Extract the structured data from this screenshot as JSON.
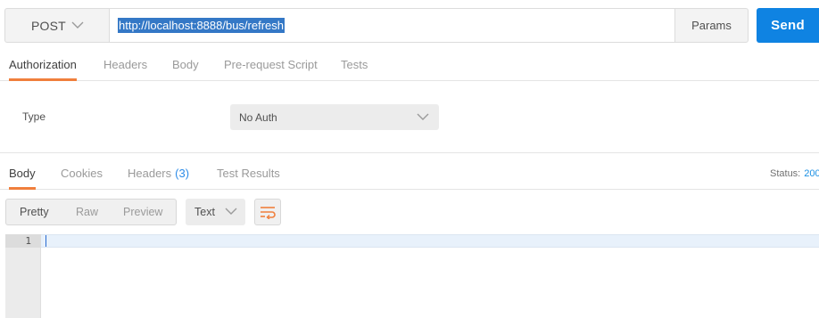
{
  "request": {
    "method": "POST",
    "url": "http://localhost:8888/bus/refresh",
    "params_label": "Params",
    "send_label": "Send"
  },
  "request_tabs": [
    {
      "label": "Authorization",
      "active": true
    },
    {
      "label": "Headers",
      "active": false
    },
    {
      "label": "Body",
      "active": false
    },
    {
      "label": "Pre-request Script",
      "active": false
    },
    {
      "label": "Tests",
      "active": false
    }
  ],
  "auth": {
    "type_label": "Type",
    "type_value": "No Auth"
  },
  "response_tabs": [
    {
      "label": "Body",
      "active": true
    },
    {
      "label": "Cookies",
      "active": false
    },
    {
      "label": "Headers",
      "count": "(3)",
      "active": false
    },
    {
      "label": "Test Results",
      "active": false
    }
  ],
  "status": {
    "label": "Status:",
    "value": "200"
  },
  "view_modes": [
    {
      "label": "Pretty",
      "active": true
    },
    {
      "label": "Raw",
      "active": false
    },
    {
      "label": "Preview",
      "active": false
    }
  ],
  "format": {
    "value": "Text"
  },
  "editor": {
    "line_numbers": [
      "1"
    ]
  },
  "icons": {
    "method_chevron": "chevron-down-icon",
    "auth_chevron": "chevron-down-icon",
    "format_chevron": "chevron-down-icon",
    "wrap": "wrap-lines-icon"
  },
  "colors": {
    "accent": "#f07f3c",
    "send": "#0f83e2",
    "selection": "#3478c6",
    "count": "#2d8ce8"
  }
}
